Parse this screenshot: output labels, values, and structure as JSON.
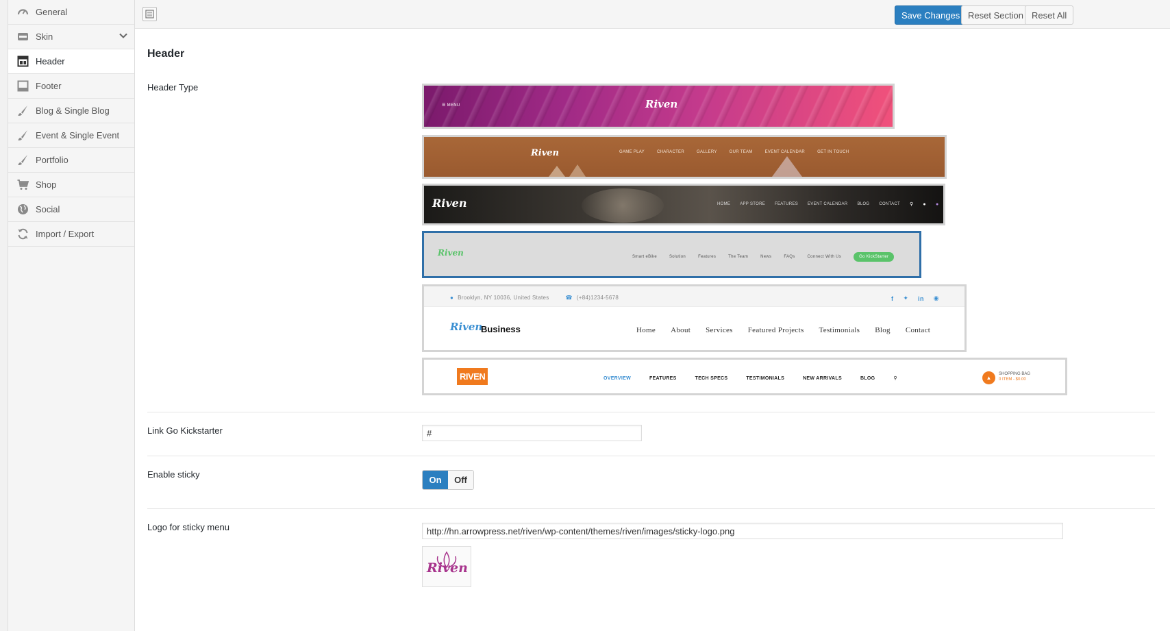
{
  "sidebar": {
    "items": [
      {
        "label": "General",
        "icon": "dashboard-icon"
      },
      {
        "label": "Skin",
        "icon": "skin-icon"
      },
      {
        "label": "Header",
        "icon": "header-layout-icon"
      },
      {
        "label": "Footer",
        "icon": "footer-layout-icon"
      },
      {
        "label": "Blog & Single Blog",
        "icon": "brush-icon"
      },
      {
        "label": "Event & Single Event",
        "icon": "brush-icon"
      },
      {
        "label": "Portfolio",
        "icon": "brush-icon"
      },
      {
        "label": "Shop",
        "icon": "cart-icon"
      },
      {
        "label": "Social",
        "icon": "globe-icon"
      },
      {
        "label": "Import / Export",
        "icon": "refresh-icon"
      }
    ],
    "active": "Header"
  },
  "toolbar": {
    "save_label": "Save Changes",
    "reset_section_label": "Reset Section",
    "reset_all_label": "Reset All"
  },
  "section": {
    "title": "Header"
  },
  "fields": {
    "header_type": {
      "label": "Header Type",
      "selected_index": 3,
      "options": [
        {
          "menu_label": "☰ MENU",
          "logo": "Riven"
        },
        {
          "logo": "Riven",
          "nav": [
            "GAME PLAY",
            "CHARACTER",
            "GALLERY",
            "OUR TEAM",
            "EVENT CALENDAR",
            "GET IN TOUCH"
          ]
        },
        {
          "logo": "Riven",
          "nav": [
            "HOME",
            "APP STORE",
            "FEATURES",
            "EVENT CALENDAR",
            "BLOG",
            "CONTACT"
          ]
        },
        {
          "logo": "Riven",
          "nav": [
            "Smart eBike",
            "Solution",
            "Features",
            "The Team",
            "News",
            "FAQs",
            "Connect With Us"
          ],
          "cta": "Go KickStarter"
        },
        {
          "address": "Brooklyn, NY 10036, United States",
          "phone": "(+84)1234-5678",
          "logo": "Riven",
          "brand": "Business",
          "nav": [
            "Home",
            "About",
            "Services",
            "Featured Projects",
            "Testimonials",
            "Blog",
            "Contact"
          ]
        },
        {
          "logo": "RIVEN",
          "nav": [
            "OVERVIEW",
            "FEATURES",
            "TECH SPECS",
            "TESTIMONIALS",
            "NEW ARRIVALS",
            "BLOG"
          ],
          "bag_title": "SHOPPING BAG",
          "bag_info": "0 ITEM - $0.00"
        }
      ]
    },
    "link_kickstarter": {
      "label": "Link Go Kickstarter",
      "value": "#"
    },
    "enable_sticky": {
      "label": "Enable sticky",
      "on_label": "On",
      "off_label": "Off",
      "value": "On"
    },
    "sticky_logo": {
      "label": "Logo for sticky menu",
      "value": "http://hn.arrowpress.net/riven/wp-content/themes/riven/images/sticky-logo.png",
      "preview_logo": "Riven"
    }
  },
  "colors": {
    "accent": "#2b7fc0",
    "selected_border": "#2f6fa8",
    "kickstarter_green": "#5ac36a",
    "orange": "#f07a1e"
  }
}
